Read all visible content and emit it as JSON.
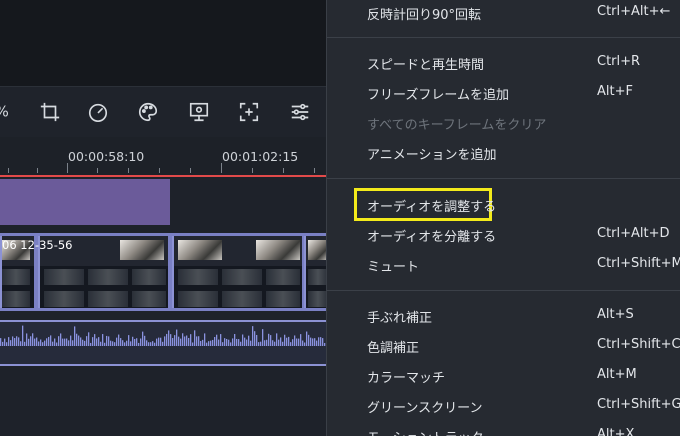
{
  "timeline": {
    "ruler": {
      "timecode_1": "00:00:58:10",
      "timecode_2": "00:01:02:15"
    },
    "clip_label": "06 12-35-56"
  },
  "toolbar": {
    "icons": [
      "speed-icon-partial",
      "crop-icon",
      "speedometer-icon",
      "color-palette-icon",
      "export-frame-icon",
      "fit-icon",
      "adjust-sliders-icon"
    ]
  },
  "menu": {
    "items": [
      {
        "label": "反時計回り90°回転",
        "shortcut": "Ctrl+Alt+←",
        "enabled": true
      },
      {
        "label": "スピードと再生時間",
        "shortcut": "Ctrl+R",
        "enabled": true
      },
      {
        "label": "フリーズフレームを追加",
        "shortcut": "Alt+F",
        "enabled": true
      },
      {
        "label": "すべてのキーフレームをクリア",
        "shortcut": "",
        "enabled": false
      },
      {
        "label": "アニメーションを追加",
        "shortcut": "",
        "enabled": true
      },
      {
        "label": "オーディオを調整する",
        "shortcut": "",
        "enabled": true,
        "highlighted": true
      },
      {
        "label": "オーディオを分離する",
        "shortcut": "Ctrl+Alt+D",
        "enabled": true
      },
      {
        "label": "ミュート",
        "shortcut": "Ctrl+Shift+M",
        "enabled": true
      },
      {
        "label": "手ぶれ補正",
        "shortcut": "Alt+S",
        "enabled": true
      },
      {
        "label": "色調補正",
        "shortcut": "Ctrl+Shift+C",
        "enabled": true
      },
      {
        "label": "カラーマッチ",
        "shortcut": "Alt+M",
        "enabled": true
      },
      {
        "label": "グリーンスクリーン",
        "shortcut": "Ctrl+Shift+G",
        "enabled": true
      },
      {
        "label": "モーショントラック",
        "shortcut": "Alt+X",
        "enabled": true
      }
    ]
  },
  "colors": {
    "highlight_border": "#f3ea1b",
    "playhead": "#e24a4a",
    "track_purple": "#6b5b9a",
    "clip_border": "#8c92d4"
  }
}
